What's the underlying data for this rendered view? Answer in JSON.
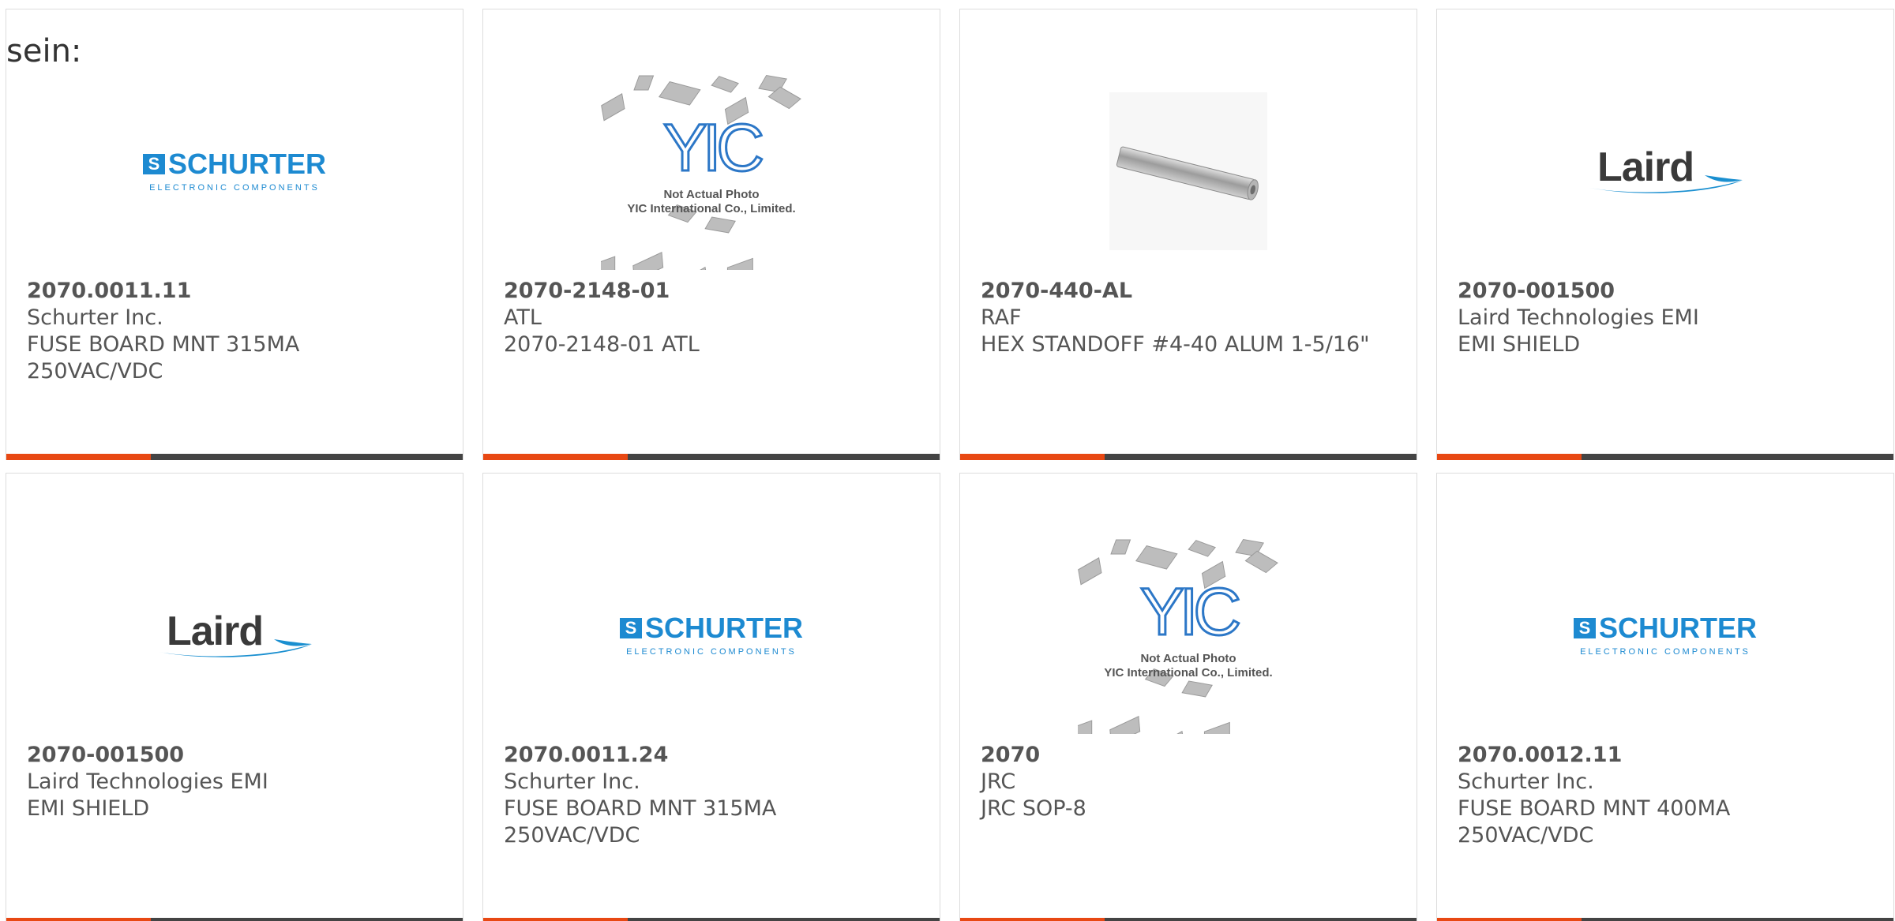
{
  "intro_text": "sein:",
  "colors": {
    "accent_bar": "#e84813",
    "bar": "#444444",
    "schurter_blue": "#1d8ad1",
    "laird_blue": "#1a8fd0"
  },
  "cards": [
    {
      "image": "schurter-logo",
      "part_number": "2070.0011.11",
      "manufacturer": "Schurter Inc.",
      "description": "FUSE BOARD MNT 315MA 250VAC/VDC"
    },
    {
      "image": "yic-placeholder",
      "part_number": "2070-2148-01",
      "manufacturer": "ATL",
      "description": "2070-2148-01 ATL"
    },
    {
      "image": "hex-standoff-photo",
      "part_number": "2070-440-AL",
      "manufacturer": "RAF",
      "description": "HEX STANDOFF #4-40 ALUM 1-5/16\""
    },
    {
      "image": "laird-logo",
      "part_number": "2070-001500",
      "manufacturer": "Laird Technologies EMI",
      "description": "EMI SHIELD"
    },
    {
      "image": "laird-logo",
      "part_number": "2070-001500",
      "manufacturer": "Laird Technologies EMI",
      "description": "EMI SHIELD"
    },
    {
      "image": "schurter-logo",
      "part_number": "2070.0011.24",
      "manufacturer": "Schurter Inc.",
      "description": "FUSE BOARD MNT 315MA 250VAC/VDC"
    },
    {
      "image": "yic-placeholder",
      "part_number": "2070",
      "manufacturer": "JRC",
      "description": "JRC SOP-8"
    },
    {
      "image": "schurter-logo",
      "part_number": "2070.0012.11",
      "manufacturer": "Schurter Inc.",
      "description": "FUSE BOARD MNT 400MA 250VAC/VDC"
    }
  ],
  "logos": {
    "schurter_word": "SCHURTER",
    "schurter_sub": "ELECTRONIC COMPONENTS",
    "schurter_mark": "S",
    "laird_word": "Laird",
    "yic_letters": "YIC",
    "yic_line1": "Not Actual Photo",
    "yic_line2": "YIC International Co., Limited."
  }
}
